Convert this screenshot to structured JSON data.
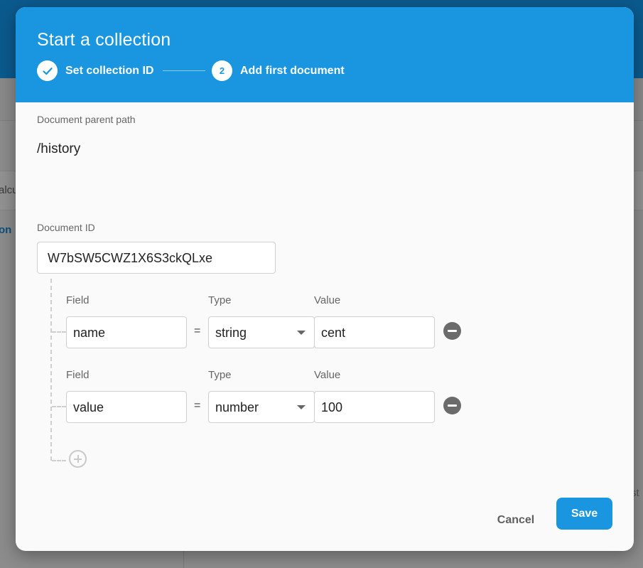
{
  "background": {
    "row_text": "alcu",
    "link_text": "on",
    "right_text": "st"
  },
  "dialog": {
    "title": "Start a collection",
    "steps": [
      {
        "label": "Set collection ID",
        "state": "done",
        "icon": "check-icon"
      },
      {
        "number": "2",
        "label": "Add first document",
        "state": "active"
      }
    ],
    "parent_path_label": "Document parent path",
    "parent_path_value": "/history",
    "document_id_label": "Document ID",
    "document_id_value": "W7bSW5CWZ1X6S3ckQLxe",
    "fields": [
      {
        "field_label": "Field",
        "type_label": "Type",
        "value_label": "Value",
        "field": "name",
        "equals": "=",
        "type": "string",
        "value": "cent"
      },
      {
        "field_label": "Field",
        "type_label": "Type",
        "value_label": "Value",
        "field": "value",
        "equals": "=",
        "type": "number",
        "value": "100"
      }
    ],
    "cancel_label": "Cancel",
    "save_label": "Save"
  },
  "colors": {
    "accent": "#1a96e0",
    "header_dark": "#0b5a8e"
  }
}
